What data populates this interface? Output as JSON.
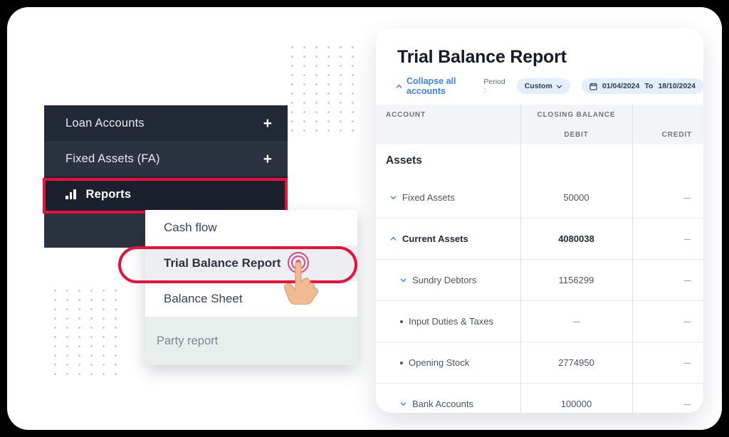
{
  "sidebar": {
    "items": [
      {
        "label": "Loan Accounts",
        "icon": "plus-icon",
        "expandable": true,
        "active": false
      },
      {
        "label": "Fixed Assets (FA)",
        "icon": "plus-icon",
        "expandable": true,
        "active": false
      },
      {
        "label": "Reports",
        "icon": "bar-chart-icon",
        "expandable": false,
        "active": true
      }
    ]
  },
  "dropdown": {
    "items": [
      {
        "label": "Cash flow",
        "selected": false
      },
      {
        "label": "Trial Balance Report",
        "selected": true
      },
      {
        "label": "Balance Sheet",
        "selected": false
      }
    ],
    "footer_label": "Party report"
  },
  "report": {
    "title": "Trial Balance Report",
    "toolbar": {
      "collapse_label": "Collapse all accounts",
      "collapse_icon": "chevron-up-icon",
      "period_label": "Period :",
      "period_value": "Custom",
      "period_caret_icon": "chevron-down-icon",
      "calendar_icon": "calendar-icon",
      "date_from": "01/04/2024",
      "date_separator": "To",
      "date_to": "18/10/2024"
    },
    "columns": {
      "account": "ACCOUNT",
      "closing_balance": "CLOSING BALANCE",
      "debit": "DEBIT",
      "credit": "CREDIT"
    },
    "rows": [
      {
        "label": "Assets",
        "debit": "",
        "credit": "",
        "type": "group",
        "indent": 0,
        "marker": "none"
      },
      {
        "label": "Fixed Assets",
        "debit": "50000",
        "credit": "---",
        "type": "item",
        "indent": 1,
        "marker": "chevron-down-icon"
      },
      {
        "label": "Current Assets",
        "debit": "4080038",
        "credit": "---",
        "type": "item-bold",
        "indent": 1,
        "marker": "chevron-up-icon"
      },
      {
        "label": "Sundry Debtors",
        "debit": "1156299",
        "credit": "---",
        "type": "item",
        "indent": 2,
        "marker": "chevron-down-icon"
      },
      {
        "label": "Input Duties & Taxes",
        "debit": "---",
        "credit": "---",
        "type": "item",
        "indent": 2,
        "marker": "bullet"
      },
      {
        "label": "Opening Stock",
        "debit": "2774950",
        "credit": "---",
        "type": "item",
        "indent": 2,
        "marker": "bullet"
      },
      {
        "label": "Bank Accounts",
        "debit": "100000",
        "credit": "---",
        "type": "item",
        "indent": 2,
        "marker": "chevron-down-icon"
      }
    ]
  },
  "colors": {
    "highlight_red": "#e8103c",
    "sidebar_dark": "#212936",
    "link_blue": "#3b82f6",
    "pill_blue": "#e3effc"
  },
  "cursor": {
    "icon": "tap-hand-icon"
  }
}
